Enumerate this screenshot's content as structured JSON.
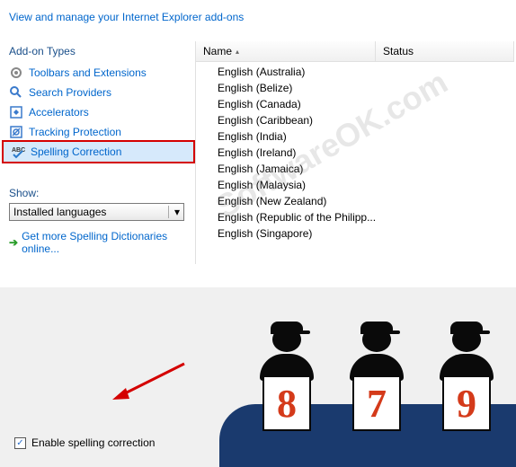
{
  "header": {
    "manage_link": "View and manage your Internet Explorer add-ons"
  },
  "sidebar": {
    "types_label": "Add-on Types",
    "items": [
      {
        "label": "Toolbars and Extensions",
        "icon": "gear-icon"
      },
      {
        "label": "Search Providers",
        "icon": "search-icon"
      },
      {
        "label": "Accelerators",
        "icon": "accelerator-icon"
      },
      {
        "label": "Tracking Protection",
        "icon": "tracking-icon"
      },
      {
        "label": "Spelling Correction",
        "icon": "spellcheck-icon"
      }
    ],
    "show_label": "Show:",
    "dropdown_value": "Installed languages",
    "online_link": "Get more Spelling Dictionaries online..."
  },
  "content": {
    "columns": {
      "name": "Name",
      "status": "Status"
    },
    "languages": [
      "English (Australia)",
      "English (Belize)",
      "English (Canada)",
      "English (Caribbean)",
      "English (India)",
      "English (Ireland)",
      "English (Jamaica)",
      "English (Malaysia)",
      "English (New Zealand)",
      "English (Republic of the Philipp...",
      "English (Singapore)"
    ]
  },
  "bottom": {
    "enable_label": "Enable spelling correction",
    "enable_checked": true
  },
  "overlay": {
    "scores": [
      "8",
      "7",
      "9"
    ],
    "watermark": "SoftwareOK.com"
  }
}
